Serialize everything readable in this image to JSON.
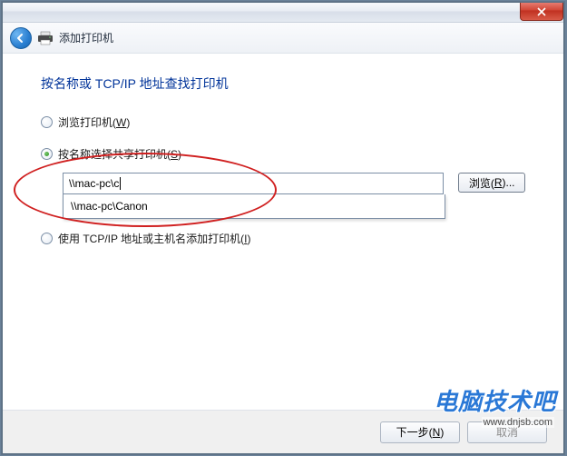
{
  "titlebar": {
    "close_icon": "close"
  },
  "nav": {
    "title": "添加打印机"
  },
  "heading": "按名称或 TCP/IP 地址查找打印机",
  "options": {
    "browse": {
      "label_pre": "浏览打印机(",
      "accel": "W",
      "label_post": ")"
    },
    "by_name": {
      "label_pre": "按名称选择共享打印机(",
      "accel": "S",
      "label_post": ")"
    },
    "by_ip": {
      "label_pre": "使用 TCP/IP 地址或主机名添加打印机(",
      "accel": "I",
      "label_post": ")"
    }
  },
  "input": {
    "value": "\\\\mac-pc\\c",
    "suggestion": "\\\\mac-pc\\Canon"
  },
  "buttons": {
    "browse": {
      "pre": "浏览(",
      "accel": "R",
      "post": ")..."
    },
    "next": {
      "pre": "下一步(",
      "accel": "N",
      "post": ")"
    },
    "cancel": "取消"
  },
  "watermark": {
    "cn": "电脑技术吧",
    "url": "www.dnjsb.com"
  }
}
